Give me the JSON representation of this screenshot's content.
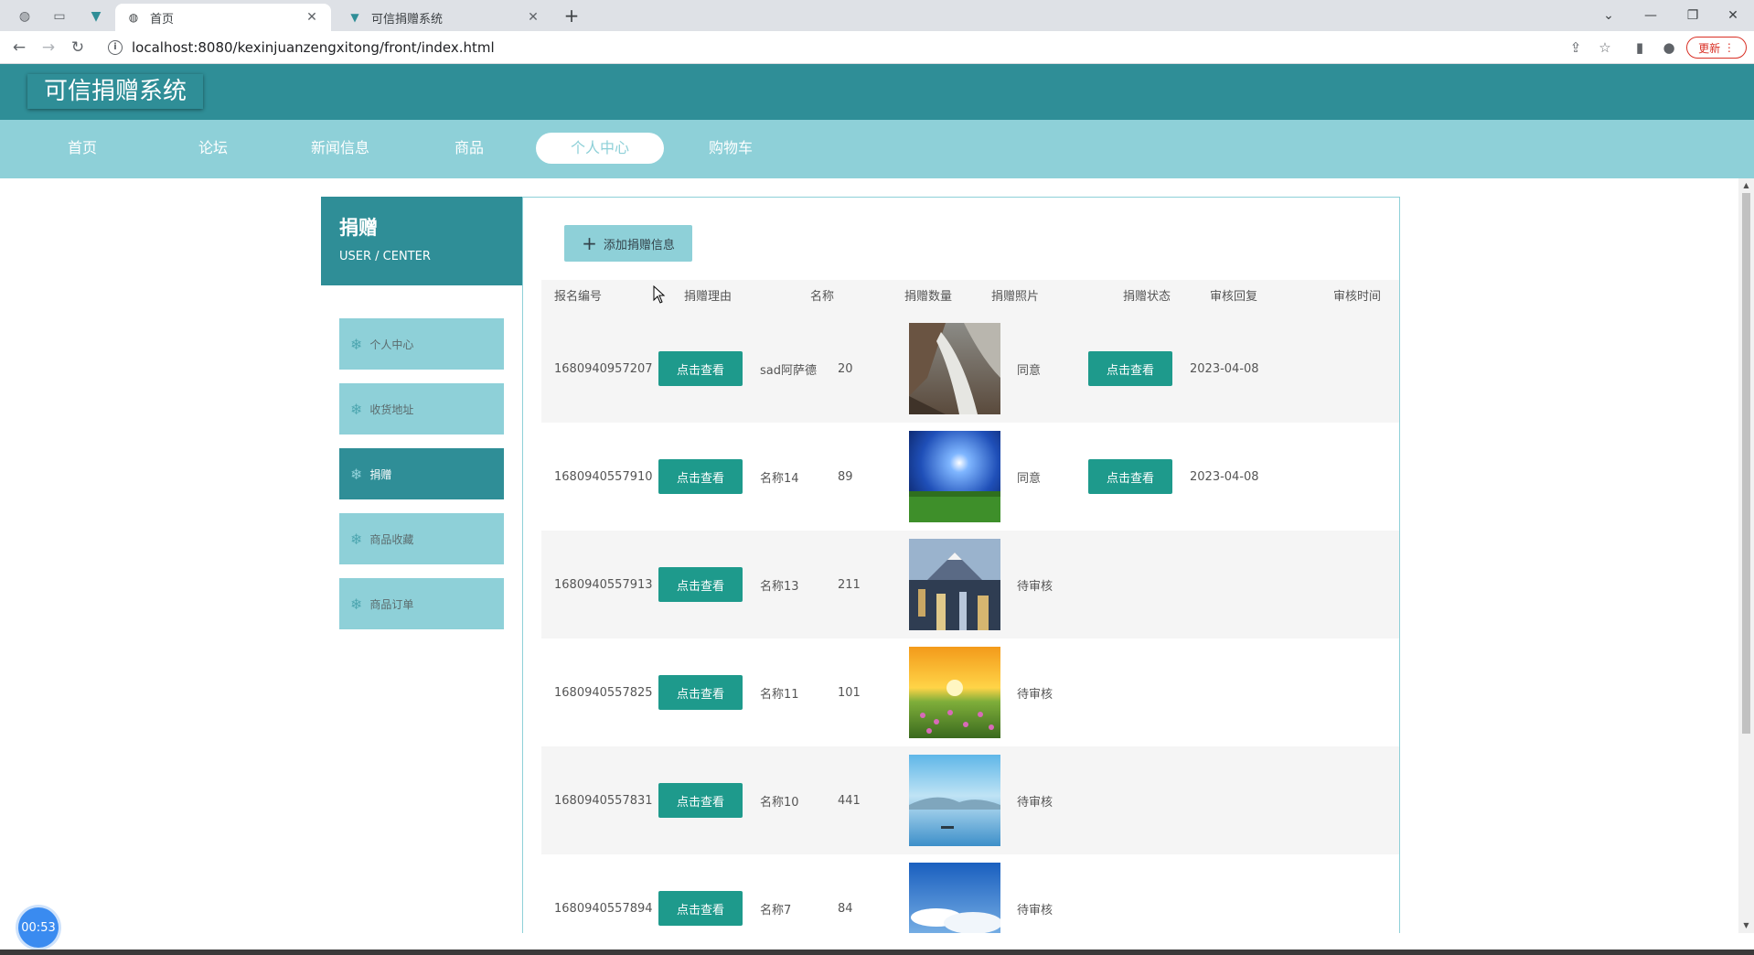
{
  "browser": {
    "tabs": [
      {
        "title": "首页",
        "active": true,
        "icon": "globe-icon"
      },
      {
        "title": "可信捐赠系统",
        "active": false,
        "icon": "vue-icon"
      }
    ],
    "url": "localhost:8080/kexinjuanzengxitong/front/index.html",
    "update_label": "更新"
  },
  "site": {
    "logo": "可信捐赠系统",
    "nav": [
      "首页",
      "论坛",
      "新闻信息",
      "商品",
      "个人中心",
      "购物车"
    ],
    "active_nav": "个人中心"
  },
  "sidebar": {
    "title": "捐赠",
    "subtitle": "USER / CENTER",
    "items": [
      "个人中心",
      "收货地址",
      "捐赠",
      "商品收藏",
      "商品订单"
    ],
    "active_item": "捐赠"
  },
  "main": {
    "add_button": "添加捐赠信息",
    "columns": [
      "报名编号",
      "捐赠理由",
      "名称",
      "捐赠数量",
      "捐赠照片",
      "捐赠状态",
      "审核回复",
      "审核时间"
    ],
    "view_label": "点击查看",
    "rows": [
      {
        "id": "1680940957207",
        "name": "sad阿萨德",
        "qty": "20",
        "photo": "waterfall",
        "status": "同意",
        "reply": true,
        "time": "2023-04-08"
      },
      {
        "id": "1680940557910",
        "name": "名称14",
        "qty": "89",
        "photo": "sun-field",
        "status": "同意",
        "reply": true,
        "time": "2023-04-08"
      },
      {
        "id": "1680940557913",
        "name": "名称13",
        "qty": "211",
        "photo": "city-mountain",
        "status": "待审核",
        "reply": false,
        "time": ""
      },
      {
        "id": "1680940557825",
        "name": "名称11",
        "qty": "101",
        "photo": "sunset-flowers",
        "status": "待审核",
        "reply": false,
        "time": ""
      },
      {
        "id": "1680940557831",
        "name": "名称10",
        "qty": "441",
        "photo": "lake-boat",
        "status": "待审核",
        "reply": false,
        "time": ""
      },
      {
        "id": "1680940557894",
        "name": "名称7",
        "qty": "84",
        "photo": "sky-clouds",
        "status": "待审核",
        "reply": false,
        "time": ""
      }
    ]
  },
  "timer": "00:53",
  "colors": {
    "header": "#2f8e97",
    "nav": "#8ed0d8",
    "button": "#1e9a8c"
  }
}
